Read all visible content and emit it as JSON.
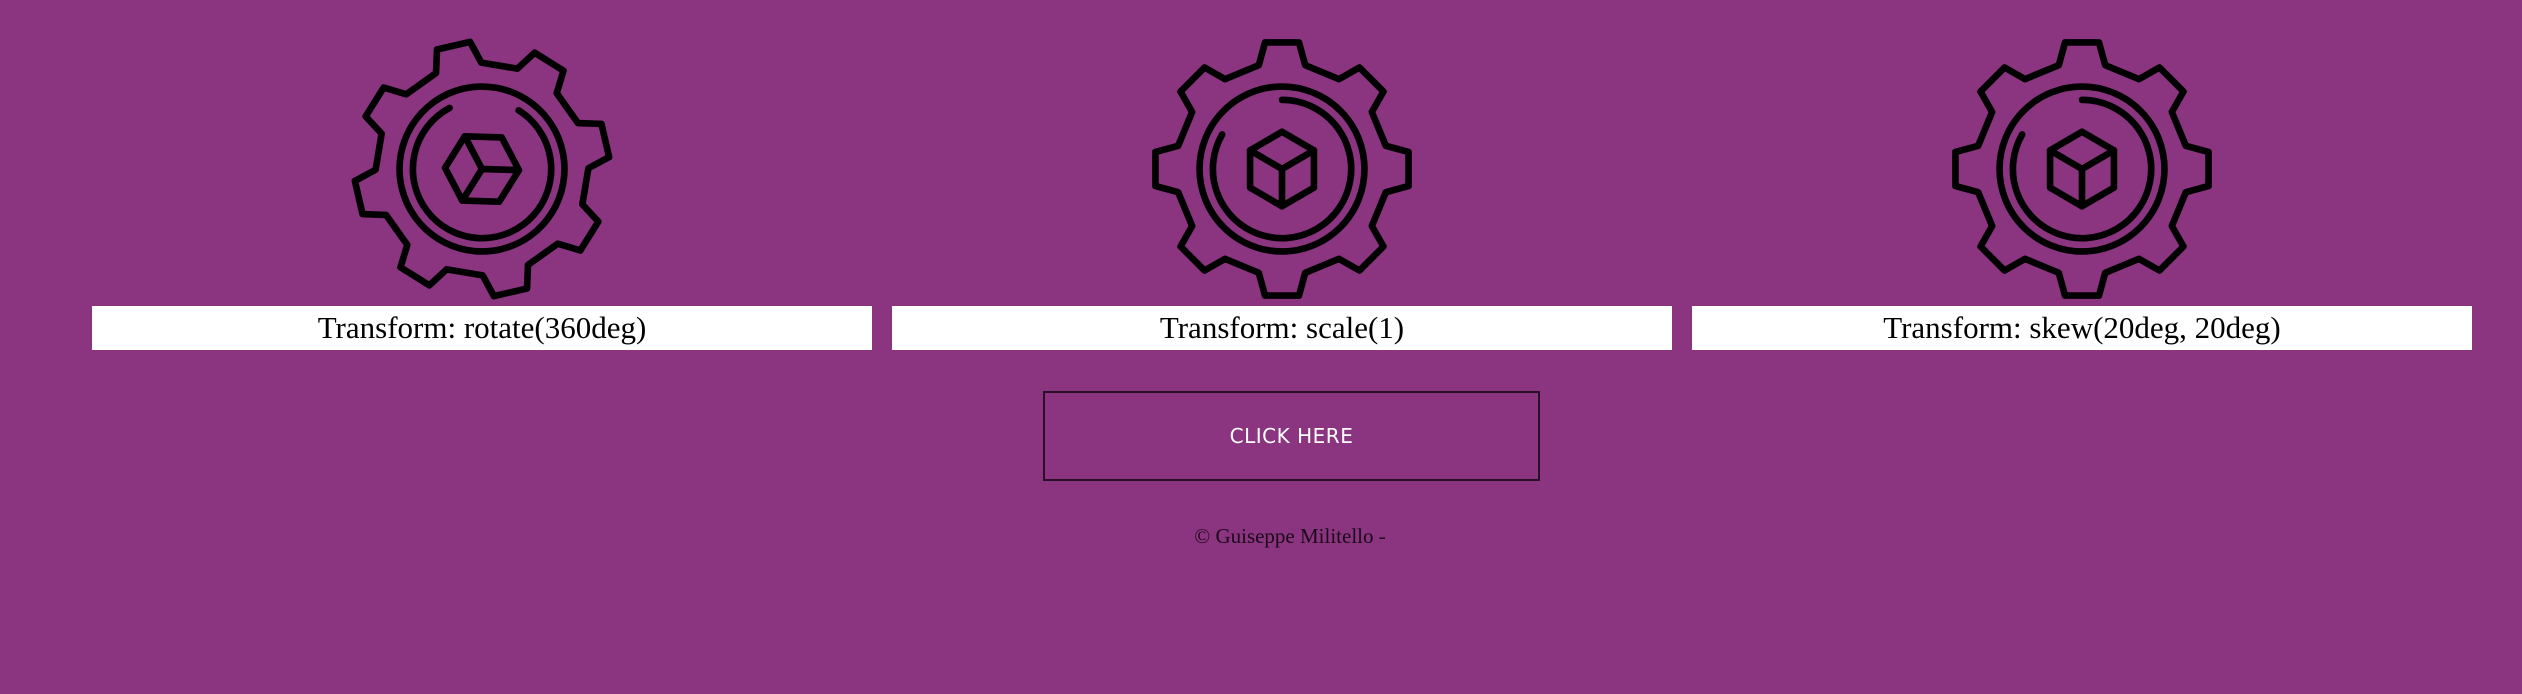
{
  "theme": {
    "background": "#8b3480",
    "label_background": "#ffffff",
    "icon_color": "#000000"
  },
  "cards": [
    {
      "label": "Transform: rotate(360deg)",
      "icon": "gear-cube-icon"
    },
    {
      "label": "Transform: scale(1)",
      "icon": "gear-cube-icon"
    },
    {
      "label": "Transform: skew(20deg, 20deg)",
      "icon": "gear-cube-icon"
    }
  ],
  "button": {
    "label": "CLICK HERE"
  },
  "footer": {
    "text": "© Guiseppe Militello -"
  }
}
